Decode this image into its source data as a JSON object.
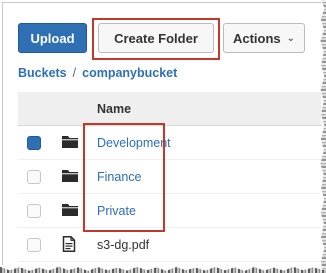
{
  "toolbar": {
    "upload_label": "Upload",
    "create_folder_label": "Create Folder",
    "actions_label": "Actions"
  },
  "breadcrumb": {
    "root": "Buckets",
    "separator": "/",
    "bucket": "companybucket"
  },
  "table": {
    "column_name": "Name",
    "rows": [
      {
        "name": "Development",
        "type": "folder",
        "checked": true
      },
      {
        "name": "Finance",
        "type": "folder",
        "checked": false
      },
      {
        "name": "Private",
        "type": "folder",
        "checked": false
      },
      {
        "name": "s3-dg.pdf",
        "type": "file",
        "checked": false
      }
    ]
  },
  "colors": {
    "primary": "#2f6fb3",
    "highlight": "#c0392b"
  },
  "icons": {
    "folder": "folder-icon",
    "file": "file-icon",
    "dropdown": "chevron-down-icon"
  }
}
